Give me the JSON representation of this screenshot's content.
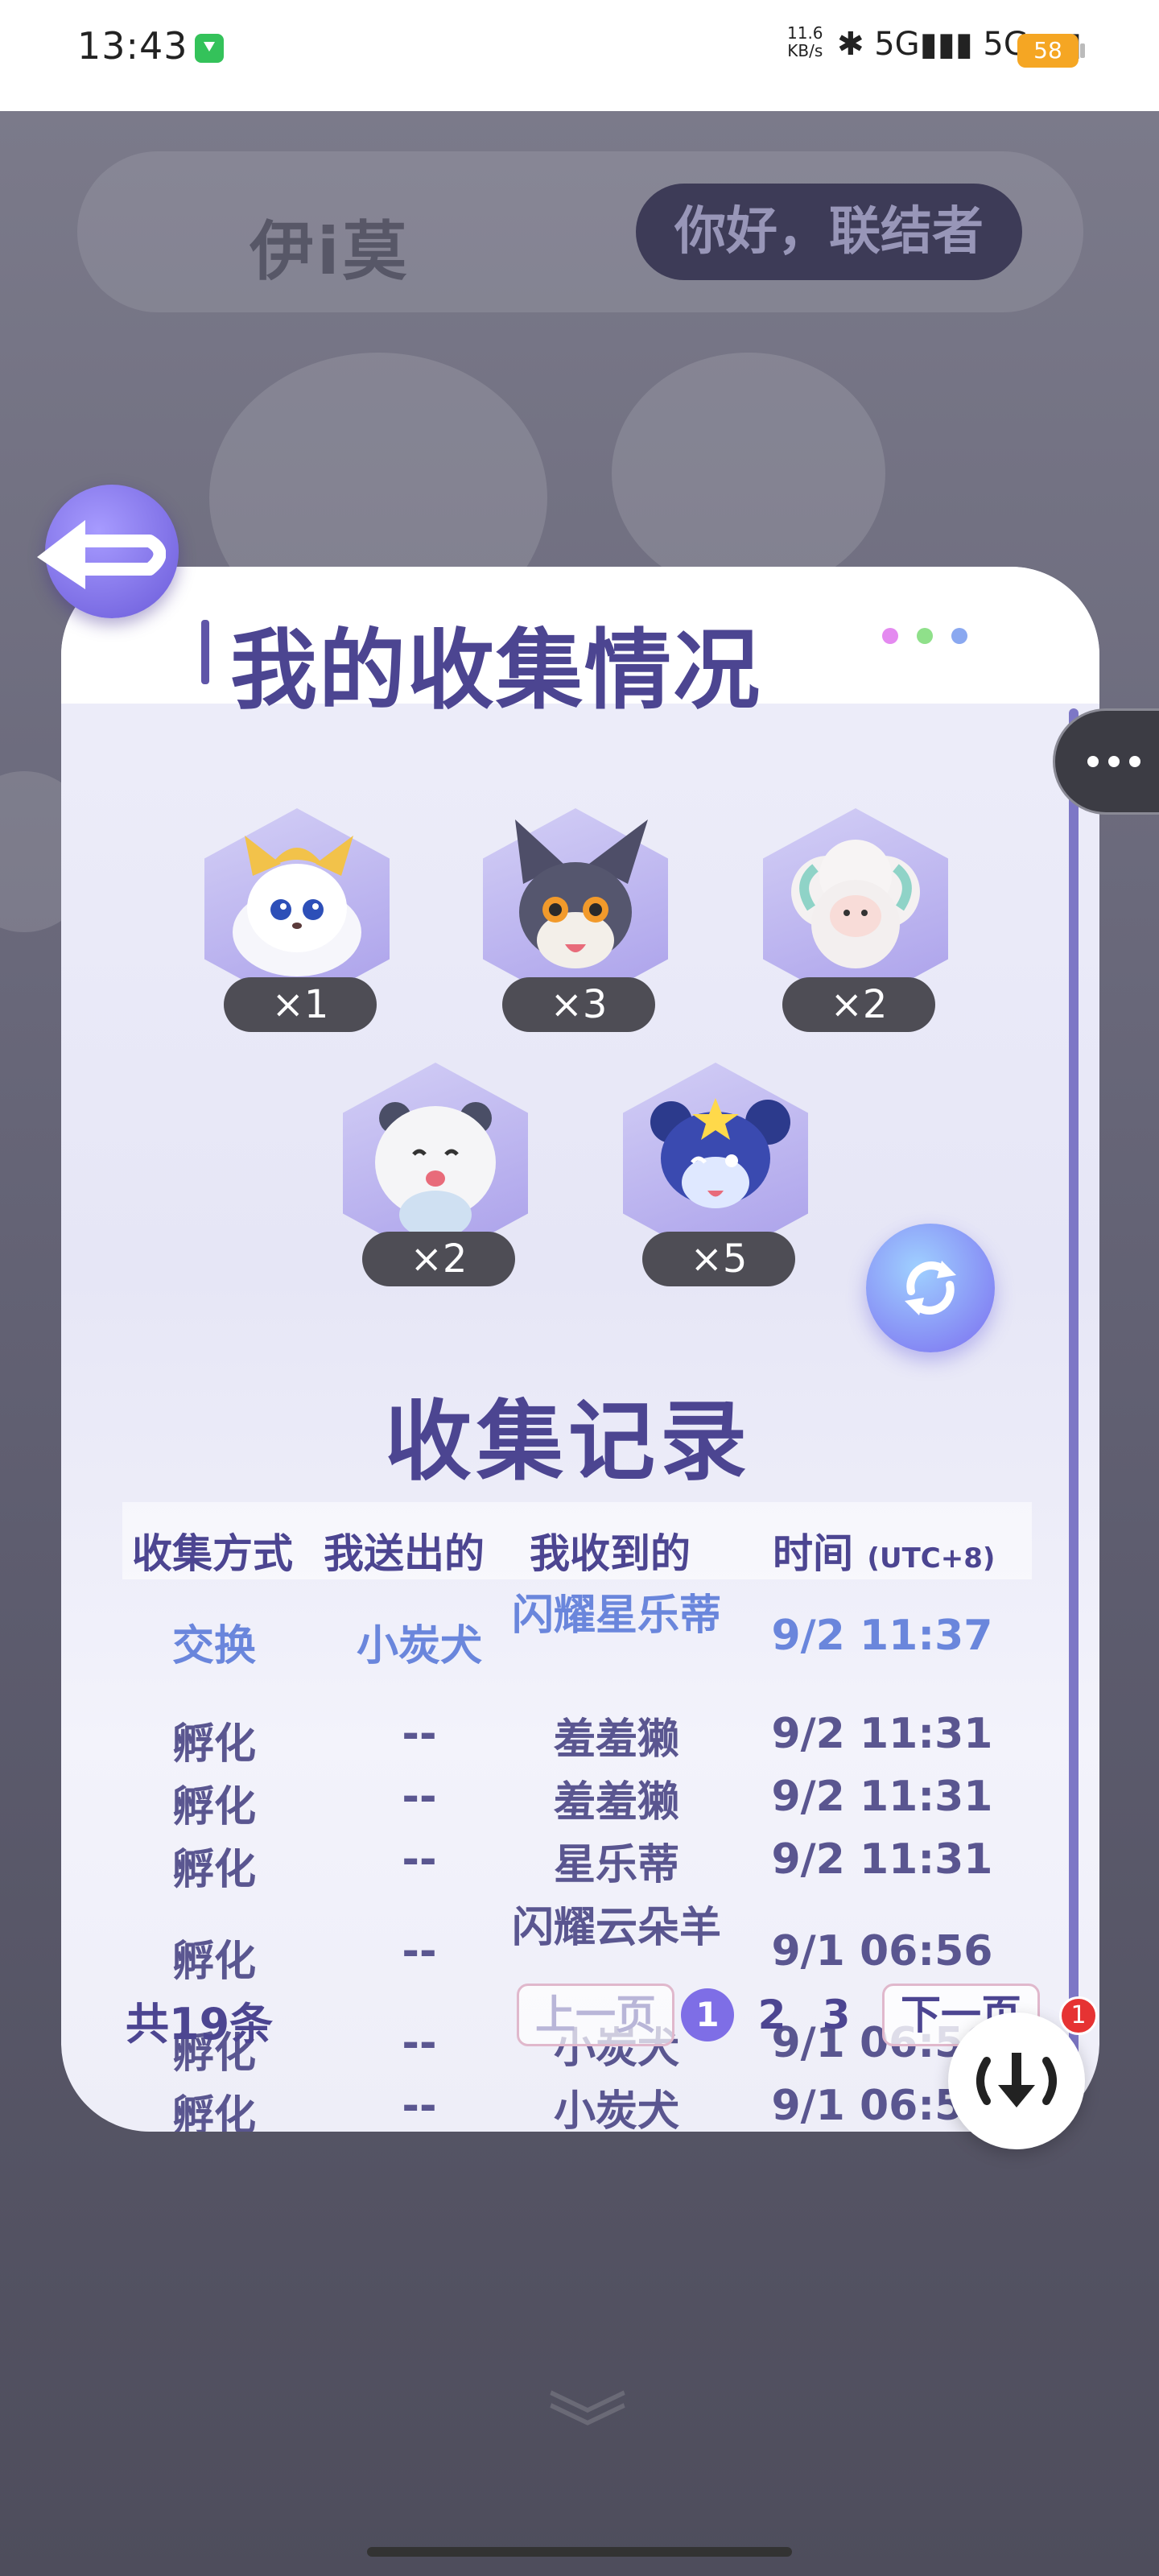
{
  "status_bar": {
    "time": "13:43",
    "net_speed": "11.6",
    "net_unit": "KB/s",
    "signal_icons": "✱ 5G▮▮▮ 5G▮▮▮",
    "battery": "58"
  },
  "background": {
    "logo": "伊i莫",
    "greeting": "你好，联结者"
  },
  "panel": {
    "title": "我的收集情况",
    "dots_colors": [
      "#e48af0",
      "#8fe08a",
      "#8aa8f0"
    ],
    "items": [
      {
        "name": "golden-fox",
        "count": "×1"
      },
      {
        "name": "dark-fox",
        "count": "×3"
      },
      {
        "name": "cloud-sheep",
        "count": "×2"
      },
      {
        "name": "white-otter",
        "count": "×2"
      },
      {
        "name": "star-squirrel",
        "count": "×5"
      }
    ],
    "record_title": "收集记录",
    "columns": {
      "method": "收集方式",
      "sent": "我送出的",
      "received": "我收到的",
      "time": "时间",
      "time_zone": "(UTC+8)"
    },
    "rows": [
      {
        "method": "交换",
        "sent": "小炭犬",
        "received": "闪耀星乐蒂",
        "time": "9/2 11:37"
      },
      {
        "method": "孵化",
        "sent": "--",
        "received": "羞羞獭",
        "time": "9/2 11:31"
      },
      {
        "method": "孵化",
        "sent": "--",
        "received": "羞羞獭",
        "time": "9/2 11:31"
      },
      {
        "method": "孵化",
        "sent": "--",
        "received": "星乐蒂",
        "time": "9/2 11:31"
      },
      {
        "method": "孵化",
        "sent": "--",
        "received": "闪耀云朵羊",
        "time": "9/1 06:56"
      },
      {
        "method": "孵化",
        "sent": "--",
        "received": "小炭犬",
        "time": "9/1 06:56"
      },
      {
        "method": "孵化",
        "sent": "--",
        "received": "小炭犬",
        "time": "9/1 06:56"
      }
    ],
    "pager": {
      "total": "共19条",
      "prev": "上一页",
      "pages": [
        "1",
        "2",
        "3"
      ],
      "next": "下一页"
    }
  },
  "float_badge": "1"
}
